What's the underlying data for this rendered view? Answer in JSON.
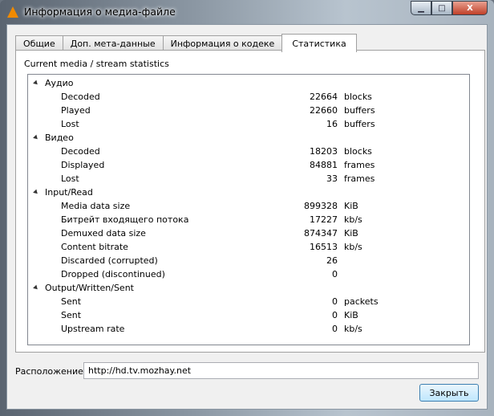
{
  "window": {
    "title": "Информация о медиа-файле",
    "minimize": "▁",
    "maximize": "□",
    "close": "X"
  },
  "tabs": [
    {
      "label": "Общие"
    },
    {
      "label": "Доп. мета-данные"
    },
    {
      "label": "Информация о кодеке"
    },
    {
      "label": "Статистика"
    }
  ],
  "panel_label": "Current media / stream statistics",
  "groups": [
    {
      "name": "Аудио",
      "rows": [
        {
          "label": "Decoded",
          "value": "22664",
          "unit": "blocks"
        },
        {
          "label": "Played",
          "value": "22660",
          "unit": "buffers"
        },
        {
          "label": "Lost",
          "value": "16",
          "unit": "buffers"
        }
      ]
    },
    {
      "name": "Видео",
      "rows": [
        {
          "label": "Decoded",
          "value": "18203",
          "unit": "blocks"
        },
        {
          "label": "Displayed",
          "value": "84881",
          "unit": "frames"
        },
        {
          "label": "Lost",
          "value": "33",
          "unit": "frames"
        }
      ]
    },
    {
      "name": "Input/Read",
      "rows": [
        {
          "label": "Media data size",
          "value": "899328",
          "unit": "KiB"
        },
        {
          "label": "Битрейт входящего потока",
          "value": "17227",
          "unit": "kb/s"
        },
        {
          "label": "Demuxed data size",
          "value": "874347",
          "unit": "KiB"
        },
        {
          "label": "Content bitrate",
          "value": "16513",
          "unit": "kb/s"
        },
        {
          "label": "Discarded (corrupted)",
          "value": "26",
          "unit": ""
        },
        {
          "label": "Dropped (discontinued)",
          "value": "0",
          "unit": ""
        }
      ]
    },
    {
      "name": "Output/Written/Sent",
      "rows": [
        {
          "label": "Sent",
          "value": "0",
          "unit": "packets"
        },
        {
          "label": "Sent",
          "value": "0",
          "unit": "KiB"
        },
        {
          "label": "Upstream rate",
          "value": "0",
          "unit": "kb/s"
        }
      ]
    }
  ],
  "location": {
    "label": "Расположение:",
    "value": "http://hd.tv.mozhay.net"
  },
  "close_button": "Закрыть"
}
